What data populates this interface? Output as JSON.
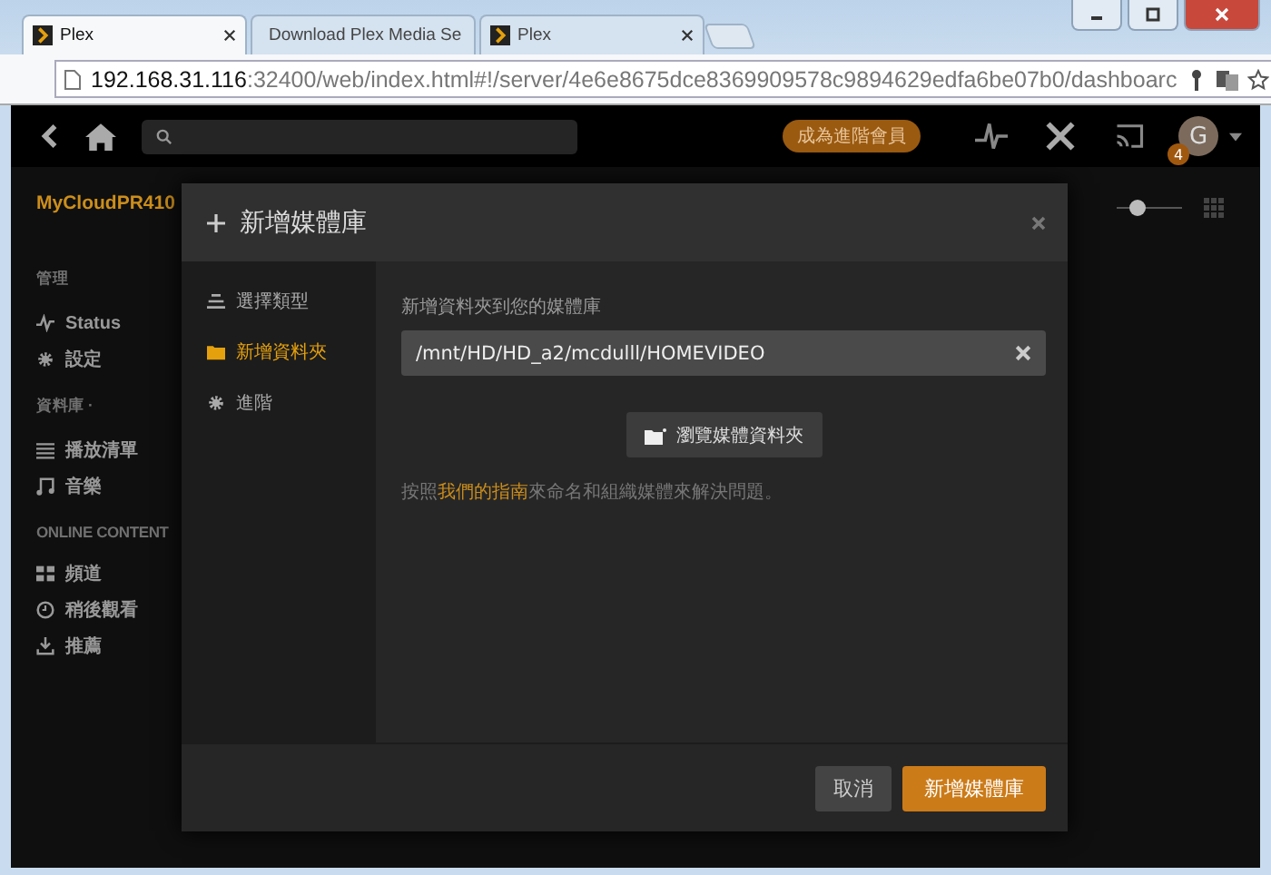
{
  "browser": {
    "tabs": [
      {
        "title": "Plex",
        "selected": true
      },
      {
        "title": "Download Plex Media Se",
        "selected": false
      },
      {
        "title": "Plex",
        "selected": false
      }
    ],
    "url_host": "192.168.31.116",
    "url_rest": ":32400/web/index.html#!/server/4e6e8675dce8369909578c9894629edfa6be07b0/dashboarc"
  },
  "topbar": {
    "premium_button": "成為進階會員",
    "notification_count": "4",
    "avatar_letter": "G"
  },
  "server_name": "MyCloudPR410",
  "slider": {
    "level": 0.3
  },
  "sidebar": {
    "sections": [
      {
        "heading": "管理",
        "items": [
          {
            "label": "Status"
          },
          {
            "label": "設定"
          }
        ]
      },
      {
        "heading": "資料庫 ·",
        "items": [
          {
            "label": "播放清單"
          },
          {
            "label": "音樂"
          }
        ]
      },
      {
        "heading": "ONLINE CONTENT",
        "items": [
          {
            "label": "頻道"
          },
          {
            "label": "稍後觀看"
          },
          {
            "label": "推薦"
          }
        ]
      }
    ]
  },
  "modal": {
    "title": "新增媒體庫",
    "steps": [
      {
        "label": "選擇類型",
        "selected": false
      },
      {
        "label": "新增資料夾",
        "selected": true
      },
      {
        "label": "進階",
        "selected": false
      }
    ],
    "field_label": "新增資料夾到您的媒體庫",
    "path": "/mnt/HD/HD_a2/mcdulll/HOMEVIDEO",
    "browse_button": "瀏覽媒體資料夾",
    "help_before": "按照",
    "help_link": "我們的指南",
    "help_after": "來命名和組織媒體來解決問題。",
    "cancel_button": "取消",
    "submit_button": "新增媒體庫"
  }
}
